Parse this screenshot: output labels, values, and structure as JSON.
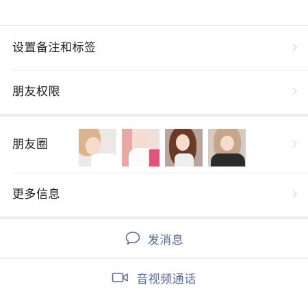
{
  "menu": {
    "remark_label": "设置备注和标签",
    "permission_label": "朋友权限"
  },
  "profile": {
    "moments_label": "朋友圈",
    "more_label": "更多信息"
  },
  "actions": {
    "message_label": "发消息",
    "video_call_label": "音视频通话"
  },
  "colors": {
    "accent": "#576b95",
    "background": "#ededed",
    "surface": "#ffffff"
  }
}
